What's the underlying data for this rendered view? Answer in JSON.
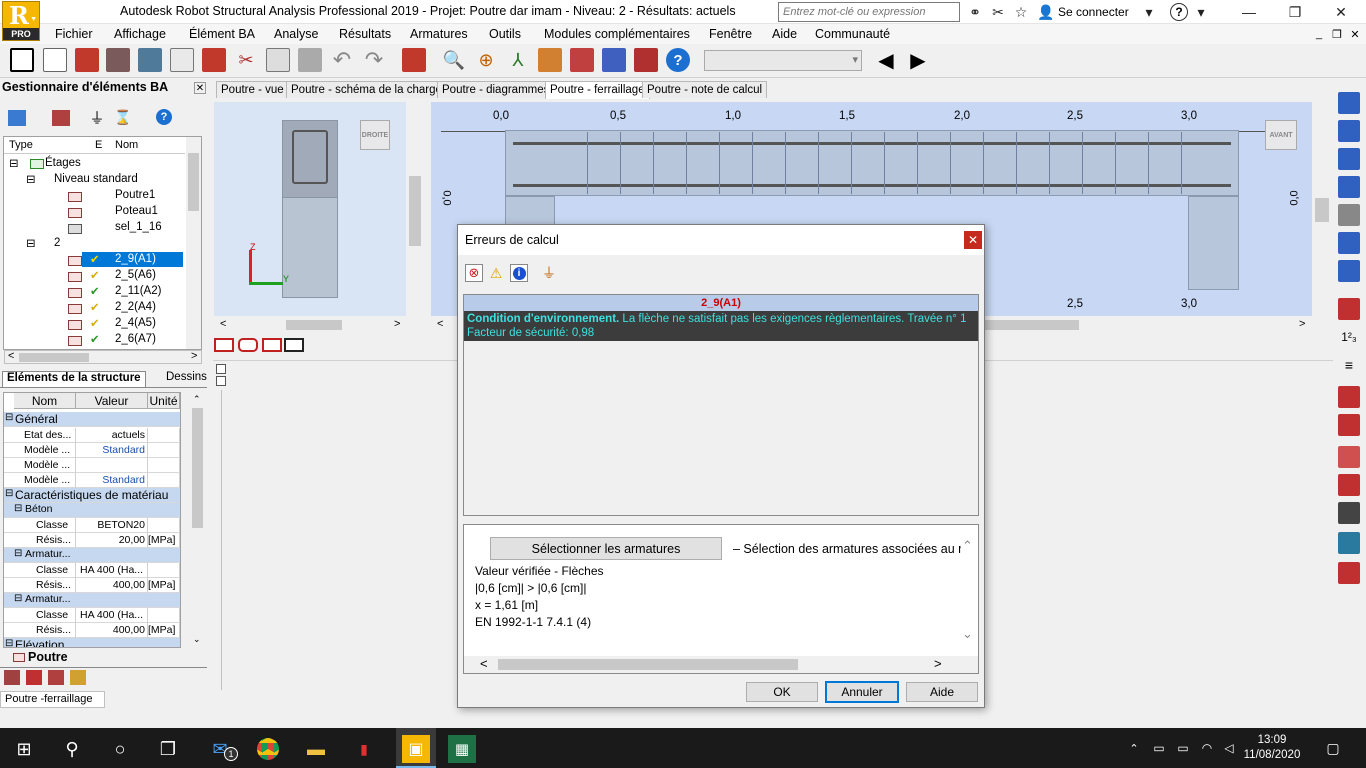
{
  "window": {
    "title": "Autodesk Robot Structural Analysis Professional 2019 - Projet: Poutre dar imam - Niveau: 2 - Résultats: actuels",
    "logo_letter": "R",
    "logo_edition": "PRO",
    "search_placeholder": "Entrez mot-clé ou expression",
    "login_label": "Se connecter"
  },
  "menu": [
    "Fichier",
    "Affichage",
    "Élément BA",
    "Analyse",
    "Résultats",
    "Armatures",
    "Outils",
    "Modules complémentaires",
    "Fenêtre",
    "Aide",
    "Communauté"
  ],
  "left_panel": {
    "title": "Gestionnaire d'éléments BA",
    "tree_columns": [
      "Type",
      "E",
      "Nom"
    ],
    "tree": {
      "root": "Étages",
      "level_std": "Niveau standard",
      "std_items": [
        "Poutre1",
        "Poteau1",
        "sel_1_16"
      ],
      "level2": "2",
      "level2_items": [
        "2_9(A1)",
        "2_5(A6)",
        "2_11(A2)",
        "2_2(A4)",
        "2_4(A5)",
        "2_6(A7)"
      ]
    },
    "tabs": [
      "Eléments de la structure",
      "Dessins"
    ],
    "props_headers": [
      "Nom",
      "Valeur",
      "Unité"
    ],
    "props": {
      "cat_general": "Général",
      "r1": {
        "name": "Etat des...",
        "value": "actuels",
        "unit": ""
      },
      "r2": {
        "name": "Modèle ...",
        "value": "Standard",
        "unit": ""
      },
      "r3": {
        "name": "Modèle ...",
        "value": "",
        "unit": ""
      },
      "r4": {
        "name": "Modèle ...",
        "value": "Standard",
        "unit": ""
      },
      "cat_mat": "Caractéristiques de matériau",
      "sub_beton": "Béton",
      "r5": {
        "name": "Classe",
        "value": "BETON20",
        "unit": ""
      },
      "r6": {
        "name": "Résis...",
        "value": "20,00",
        "unit": "[MPa]"
      },
      "sub_arm1": "Armatur...",
      "r7": {
        "name": "Classe",
        "value": "HA 400 (Ha...",
        "unit": ""
      },
      "r8": {
        "name": "Résis...",
        "value": "400,00",
        "unit": "[MPa]"
      },
      "sub_arm2": "Armatur...",
      "r9": {
        "name": "Classe",
        "value": "HA 400 (Ha...",
        "unit": ""
      },
      "r10": {
        "name": "Résis...",
        "value": "400,00",
        "unit": "[MPa]"
      },
      "cat_elev": "Elévation"
    },
    "bottom_tab": "Poutre"
  },
  "view_tabs": [
    "Poutre - vue",
    "Poutre - schéma de la charge",
    "Poutre - diagrammes",
    "Poutre - ferraillage",
    "Poutre - note de calcul"
  ],
  "view_left": {
    "label_droite": "DROITE",
    "axis_z": "Z",
    "axis_y": "Y"
  },
  "view_right": {
    "ticks": [
      "0,0",
      "0,5",
      "1,0",
      "1,5",
      "2,0",
      "2,5",
      "3,0"
    ],
    "bottom_ticks": [
      "2,5",
      "3,0"
    ],
    "label_avant": "AVANT",
    "vlabel_left": "0,0",
    "vlabel_right": "0,0"
  },
  "dialog": {
    "title": "Erreurs de calcul",
    "element": "2_9(A1)",
    "error_bold": "Condition d'environnement.",
    "error_text": " La flèche ne satisfait pas les exigences règlementaires. Travée n°  1",
    "error_line2": "Facteur de sécurité: 0,98",
    "select_btn": "Sélectionner les armatures",
    "select_desc": "– Sélection des armatures associées au m",
    "detail_lines": [
      "Valeur vérifiée - Flèches",
      "|0,6 [cm]| > |0,6 [cm]|",
      "x = 1,61 [m]",
      "EN 1992-1-1 7.4.1 (4)"
    ],
    "ok": "OK",
    "cancel": "Annuler",
    "help": "Aide"
  },
  "status_text": "Poutre -ferraillage",
  "taskbar": {
    "time": "13:09",
    "date": "11/08/2020",
    "mail_badge": "1"
  }
}
